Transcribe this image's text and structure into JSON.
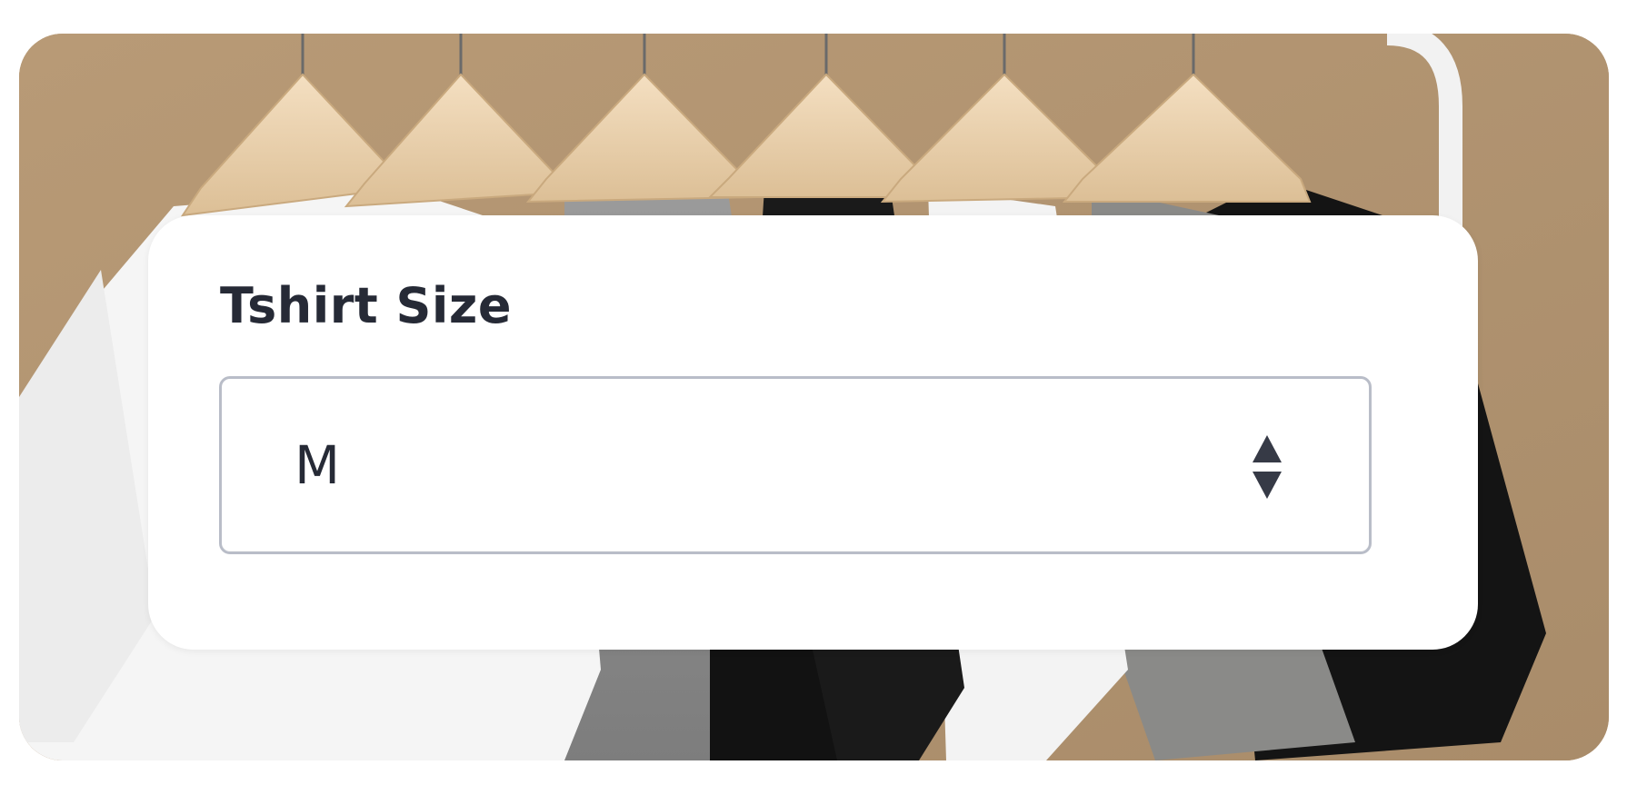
{
  "field": {
    "label": "Tshirt Size",
    "selected_value": "M"
  },
  "icons": {
    "select_indicator": "up-down-arrows-icon"
  },
  "colors": {
    "photo_background": "#b79a78",
    "panel_background": "#ffffff",
    "text": "#262a36",
    "select_border": "#b9bdc8"
  }
}
